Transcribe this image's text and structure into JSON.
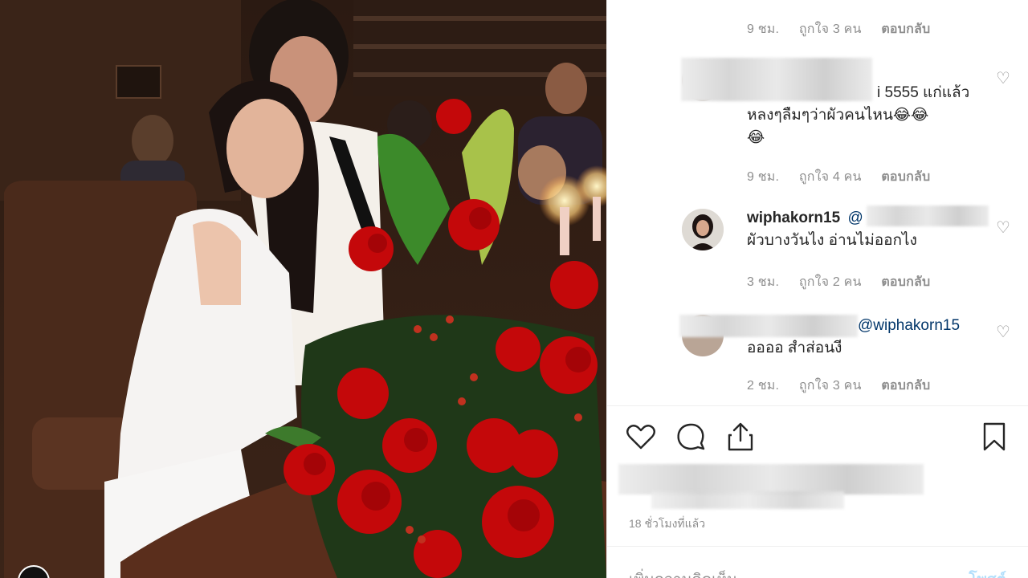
{
  "comments": [
    {
      "id": "c0",
      "text": "",
      "time": "9 ชม.",
      "likes": "ถูกใจ 3 คน",
      "reply": "ตอบกลับ"
    },
    {
      "id": "c1",
      "username": "",
      "text_line1": "i 5555 แก่แล้ว",
      "text_line2": "หลงๆลืมๆว่าผัวคนไหน😂😂",
      "text_line3": "😂",
      "time": "9 ชม.",
      "likes": "ถูกใจ 4 คน",
      "reply": "ตอบกลับ"
    },
    {
      "id": "c2",
      "username": "wiphakorn15",
      "mention_prefix": "@",
      "text_line2": "ผัวบางวันไง อ่านไม่ออกไง",
      "time": "3 ชม.",
      "likes": "ถูกใจ 2 คน",
      "reply": "ตอบกลับ"
    },
    {
      "id": "c3",
      "mention": "@wiphakorn15",
      "text_line2": "ออออ สำส่อนงี",
      "time": "2 ชม.",
      "likes": "ถูกใจ 3 คน",
      "reply": "ตอบกลับ"
    }
  ],
  "post": {
    "timestamp": "18 ชั่วโมงที่แล้ว"
  },
  "add_comment": {
    "placeholder": "เพิ่มความคิดเห็น...",
    "post_label": "โพสต์"
  },
  "icons": {
    "like": "heart-icon",
    "comment": "comment-bubble-icon",
    "share": "share-upload-icon",
    "save": "bookmark-icon",
    "comment_like": "small-heart-icon"
  },
  "colors": {
    "text": "#262626",
    "meta": "#8e8e8e",
    "mention": "#003569",
    "post_disabled": "#b2dffc"
  }
}
